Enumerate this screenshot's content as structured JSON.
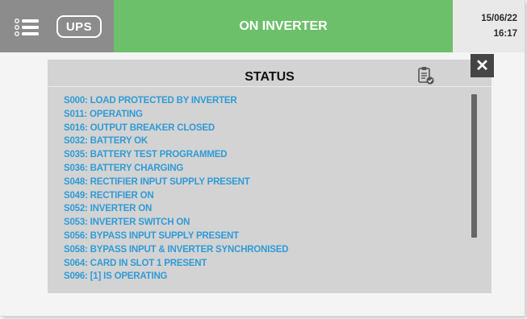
{
  "header": {
    "menu_icon": "list-menu-icon",
    "device_label": "UPS",
    "state": "ON INVERTER",
    "date": "15/06/22",
    "time": "16:17",
    "colors": {
      "state_ok": "#6cc06a",
      "bar": "#8c8c8c"
    }
  },
  "panel": {
    "title": "STATUS",
    "clipboard_icon": "clipboard-check-icon",
    "close_icon": "close-icon",
    "item_color": "#2f9bd6",
    "items": [
      "S000: LOAD PROTECTED BY INVERTER",
      "S011: OPERATING",
      "S016: OUTPUT BREAKER CLOSED",
      "S032: BATTERY OK",
      "S035: BATTERY TEST PROGRAMMED",
      "S036: BATTERY CHARGING",
      "S048: RECTIFIER INPUT SUPPLY PRESENT",
      "S049: RECTIFIER ON",
      "S052: INVERTER ON",
      "S053: INVERTER SWITCH ON",
      "S056: BYPASS INPUT SUPPLY PRESENT",
      "S058: BYPASS INPUT & INVERTER SYNCHRONISED",
      "S064: CARD IN SLOT 1 PRESENT",
      "S096: [1] IS OPERATING"
    ]
  }
}
